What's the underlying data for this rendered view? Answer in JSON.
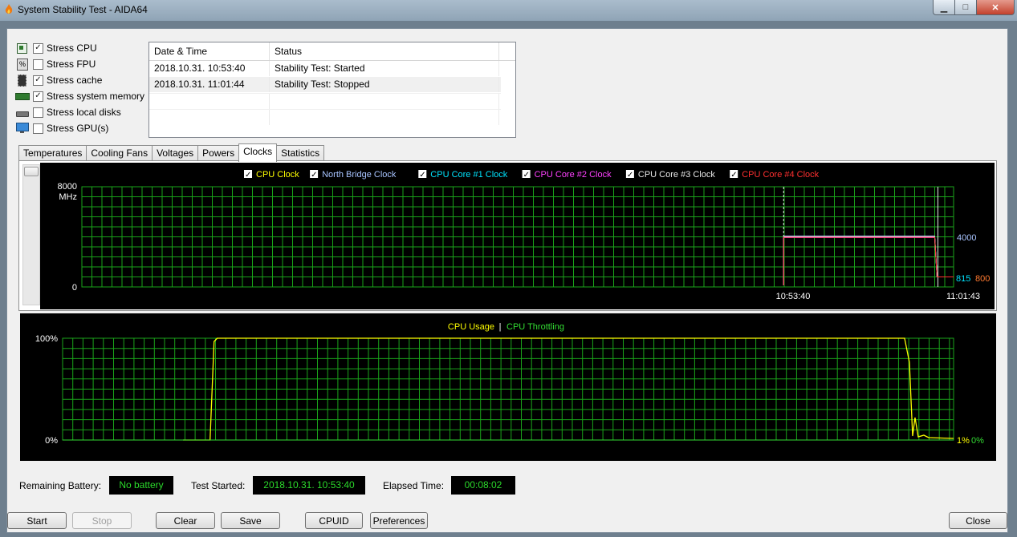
{
  "window": {
    "title": "System Stability Test - AIDA64"
  },
  "stress_options": [
    {
      "label": "Stress CPU",
      "checked": true,
      "icon": "cpu-chip-icon"
    },
    {
      "label": "Stress FPU",
      "checked": false,
      "icon": "fpu-icon"
    },
    {
      "label": "Stress cache",
      "checked": true,
      "icon": "cache-chip-icon"
    },
    {
      "label": "Stress system memory",
      "checked": true,
      "icon": "memory-module-icon"
    },
    {
      "label": "Stress local disks",
      "checked": false,
      "icon": "disk-drive-icon"
    },
    {
      "label": "Stress GPU(s)",
      "checked": false,
      "icon": "monitor-icon"
    }
  ],
  "log": {
    "columns": [
      "Date & Time",
      "Status"
    ],
    "rows": [
      {
        "datetime": "2018.10.31. 10:53:40",
        "status": "Stability Test: Started"
      },
      {
        "datetime": "2018.10.31. 11:01:44",
        "status": "Stability Test: Stopped"
      }
    ]
  },
  "tabs": [
    "Temperatures",
    "Cooling Fans",
    "Voltages",
    "Powers",
    "Clocks",
    "Statistics"
  ],
  "active_tab": "Clocks",
  "clock_graph": {
    "legend": [
      {
        "label": "CPU Clock",
        "color": "#ffff00",
        "checked": true
      },
      {
        "label": "North Bridge Clock",
        "color": "#a8c4ff",
        "checked": true
      },
      {
        "label": "CPU Core #1 Clock",
        "color": "#00e5ff",
        "checked": true
      },
      {
        "label": "CPU Core #2 Clock",
        "color": "#ff40ff",
        "checked": true
      },
      {
        "label": "CPU Core #3 Clock",
        "color": "#e8e8e8",
        "checked": true
      },
      {
        "label": "CPU Core #4 Clock",
        "color": "#ff3030",
        "checked": true
      }
    ],
    "y_top": "8000",
    "y_unit": "MHz",
    "y_bottom": "0",
    "start_time": "10:53:40",
    "end_time": "11:01:43",
    "value_high": "4000",
    "value_low_a": "815",
    "value_low_b": "800",
    "ymax": 8000,
    "high_value": 4000,
    "low_value": 800,
    "load_start_fraction": 0.805,
    "load_end_fraction": 0.982
  },
  "usage_graph": {
    "legend_usage": "CPU Usage",
    "legend_sep": "|",
    "legend_throttling": "CPU Throttling",
    "usage_color": "#ffff00",
    "throttle_color": "#33dd33",
    "y_top": "100%",
    "y_bottom": "0%",
    "current_usage": "1%",
    "current_throttling": "0%",
    "load_start_fraction": 0.17,
    "load_end_fraction": 0.945
  },
  "status_bar": {
    "battery_label": "Remaining Battery:",
    "battery_value": "No battery",
    "started_label": "Test Started:",
    "started_value": "2018.10.31. 10:53:40",
    "elapsed_label": "Elapsed Time:",
    "elapsed_value": "00:08:02"
  },
  "buttons": {
    "start": "Start",
    "stop": "Stop",
    "clear": "Clear",
    "save": "Save",
    "cpuid": "CPUID",
    "preferences": "Preferences",
    "close": "Close"
  },
  "colors": {
    "grid": "#1aa31a",
    "graph_bg": "#000000",
    "status_text": "#2bd92b"
  }
}
